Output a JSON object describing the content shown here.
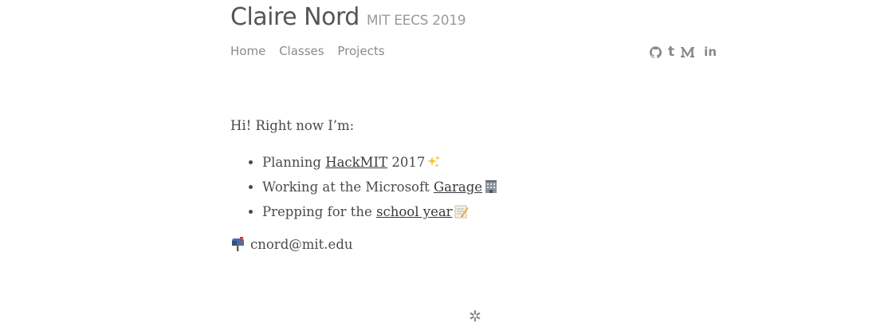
{
  "header": {
    "name": "Claire Nord",
    "subtitle": "MIT EECS 2019"
  },
  "nav": {
    "items": [
      {
        "label": "Home"
      },
      {
        "label": "Classes"
      },
      {
        "label": "Projects"
      }
    ]
  },
  "social": {
    "icons": [
      "github-icon",
      "tumblr-icon",
      "medium-icon",
      "linkedin-icon"
    ],
    "tumblr_glyph": "t",
    "linkedin_glyph": "in"
  },
  "intro": {
    "greeting": "Hi! Right now I’m:",
    "items": [
      {
        "before": "Planning ",
        "link": "HackMIT",
        "after": " 2017",
        "emoji": "sparkles-icon"
      },
      {
        "before": "Working at the Microsoft ",
        "link": "Garage",
        "after": "",
        "emoji": "building-icon"
      },
      {
        "before": "Prepping for the ",
        "link": "school year",
        "after": "",
        "emoji": "memo-icon"
      }
    ]
  },
  "contact": {
    "email": "cnord@mit.edu",
    "emoji": "mailbox-icon"
  },
  "footer": {
    "mark": "✲"
  },
  "colors": {
    "text": "#4a4a4a",
    "muted": "#8b8b8b",
    "title": "#555555"
  }
}
